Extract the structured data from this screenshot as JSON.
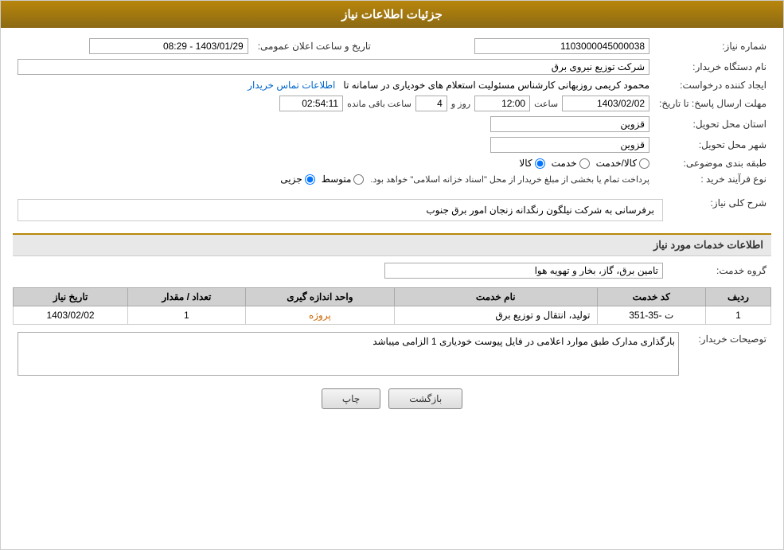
{
  "header": {
    "title": "جزئیات اطلاعات نیاز"
  },
  "form": {
    "need_number_label": "شماره نیاز:",
    "need_number_value": "1103000045000038",
    "buyer_name_label": "نام دستگاه خریدار:",
    "buyer_name_value": "شرکت توزیع نیروی برق",
    "announce_date_label": "تاریخ و ساعت اعلان عمومی:",
    "announce_date_value": "1403/01/29 - 08:29",
    "creator_label": "ایجاد کننده درخواست:",
    "creator_value": "محمود کریمی روزبهانی کارشناس  مسئولیت استعلام های خودیاری در سامانه تا",
    "contact_link": "اطلاعات تماس خریدار",
    "deadline_label": "مهلت ارسال پاسخ: تا تاریخ:",
    "deadline_date": "1403/02/02",
    "deadline_time_label": "ساعت",
    "deadline_time": "12:00",
    "deadline_days_label": "روز و",
    "deadline_days": "4",
    "remaining_label": "ساعت باقی مانده",
    "remaining_time": "02:54:11",
    "province_label": "استان محل تحویل:",
    "province_value": "قزوین",
    "city_label": "شهر محل تحویل:",
    "city_value": "قزوین",
    "category_label": "طبقه بندی موضوعی:",
    "category_options": [
      {
        "label": "کالا",
        "value": "kala"
      },
      {
        "label": "خدمت",
        "value": "khedmat"
      },
      {
        "label": "کالا/خدمت",
        "value": "kala_khedmat"
      }
    ],
    "category_selected": "kala",
    "purchase_type_label": "نوع فرآیند خرید :",
    "purchase_type_options": [
      {
        "label": "جزیی",
        "value": "jozi"
      },
      {
        "label": "متوسط",
        "value": "motavaset"
      }
    ],
    "purchase_type_selected": "jozi",
    "purchase_type_note": "پرداخت تمام یا بخشی از مبلغ خریدار از محل \"اسناد خزانه اسلامی\" خواهد بود.",
    "need_description_label": "شرح کلی نیاز:",
    "need_description_value": "برفرسانی به شرکت نیلگون رنگدانه زنجان امور برق جنوب",
    "services_section_title": "اطلاعات خدمات مورد نیاز",
    "service_group_label": "گروه خدمت:",
    "service_group_value": "تامین برق، گاز، بخار و تهویه هوا",
    "table": {
      "headers": [
        "ردیف",
        "کد خدمت",
        "نام خدمت",
        "واحد اندازه گیری",
        "تعداد / مقدار",
        "تاریخ نیاز"
      ],
      "rows": [
        {
          "row": "1",
          "service_code": "ت -35-351",
          "service_name": "تولید، انتقال و توزیع برق",
          "unit": "پروژه",
          "quantity": "1",
          "date": "1403/02/02"
        }
      ]
    },
    "buyer_notes_label": "توصیحات خریدار:",
    "buyer_notes_value": "بارگذاری مدارک طبق موارد اعلامی در فایل پیوست خودیاری 1 الزامی میباشد",
    "btn_back": "بازگشت",
    "btn_print": "چاپ"
  }
}
